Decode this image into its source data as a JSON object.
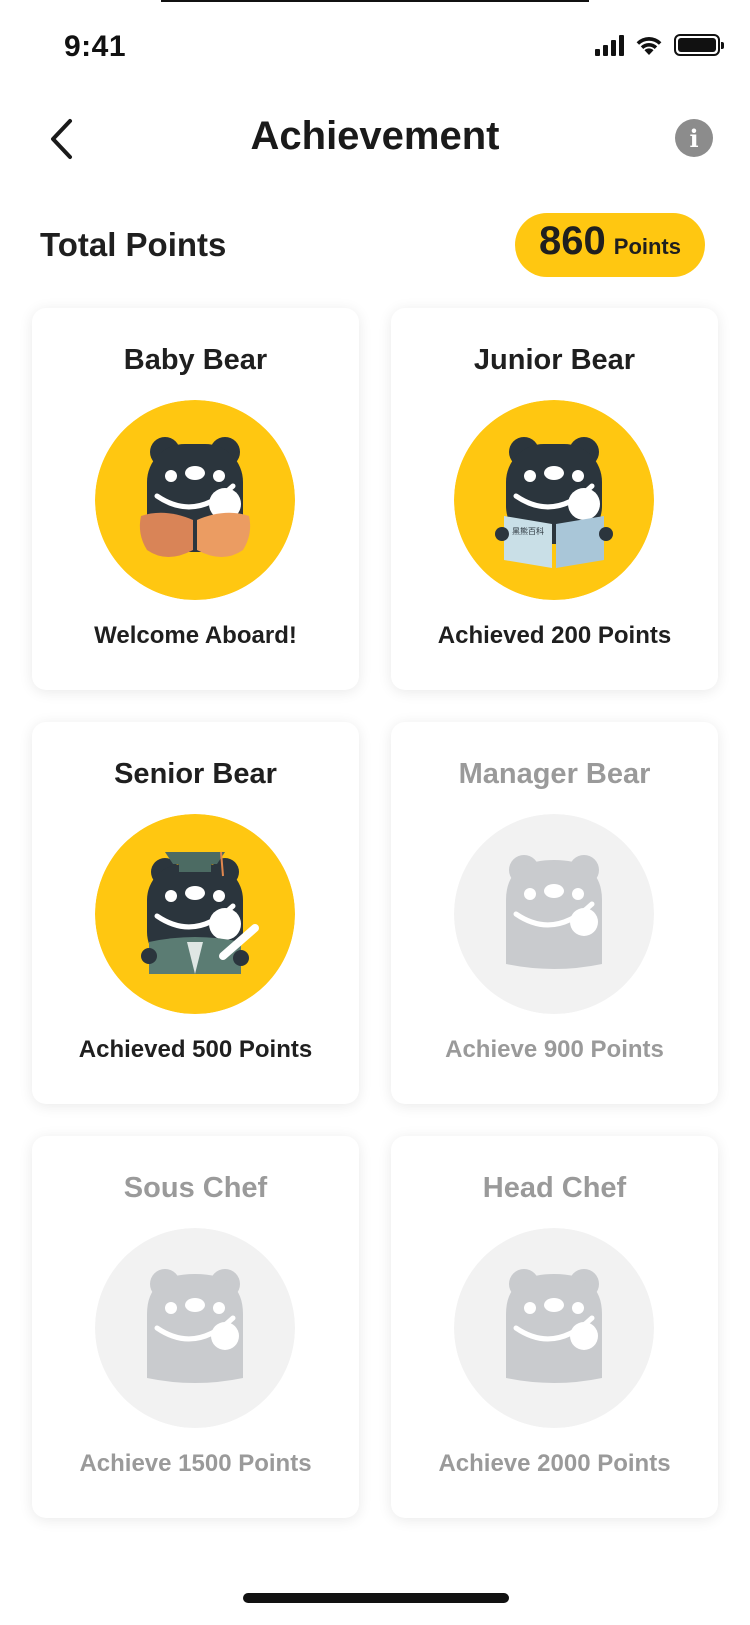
{
  "status_bar": {
    "time": "9:41"
  },
  "nav": {
    "title": "Achievement",
    "back_icon": "chevron-left-icon",
    "info_icon": "info-icon",
    "info_glyph": "i"
  },
  "points": {
    "label": "Total Points",
    "value": "860",
    "unit": "Points"
  },
  "colors": {
    "accent": "#ffc711",
    "bear": "#2b353d",
    "locked_badge": "#f2f2f2",
    "locked_bear": "#c9cbce"
  },
  "achievements": [
    {
      "title": "Baby Bear",
      "caption": "Welcome Aboard!",
      "unlocked": true,
      "icon": "baby-bear-icon"
    },
    {
      "title": "Junior Bear",
      "caption": "Achieved 200 Points",
      "unlocked": true,
      "icon": "junior-bear-icon",
      "book_text": "黑熊百科"
    },
    {
      "title": "Senior Bear",
      "caption": "Achieved 500 Points",
      "unlocked": true,
      "icon": "senior-bear-icon"
    },
    {
      "title": "Manager Bear",
      "caption": "Achieve 900 Points",
      "unlocked": false,
      "icon": "manager-bear-locked-icon"
    },
    {
      "title": "Sous Chef",
      "caption": "Achieve 1500 Points",
      "unlocked": false,
      "icon": "sous-chef-locked-icon"
    },
    {
      "title": "Head Chef",
      "caption": "Achieve 2000 Points",
      "unlocked": false,
      "icon": "head-chef-locked-icon"
    }
  ]
}
